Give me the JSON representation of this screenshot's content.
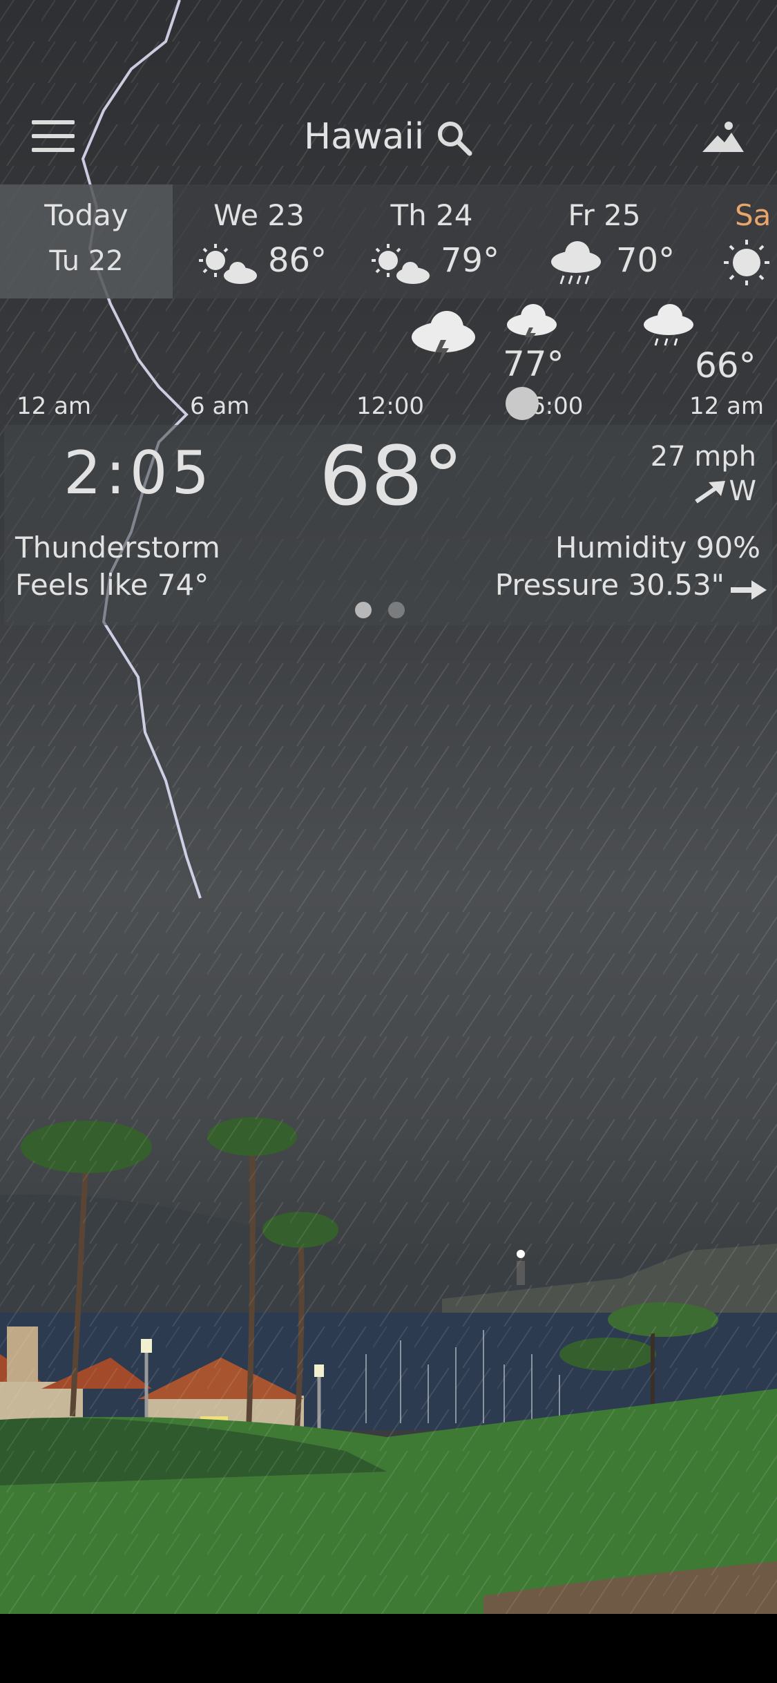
{
  "header": {
    "location": "Hawaii",
    "menu_icon": "hamburger-menu-icon",
    "search_icon": "search-icon",
    "scene_icon": "mountain-icon"
  },
  "days": [
    {
      "name": "Today",
      "sub": "Tu 22",
      "icon": "",
      "active": true
    },
    {
      "name": "We 23",
      "temp": "86°",
      "icon": "partly-sunny-icon"
    },
    {
      "name": "Th 24",
      "temp": "79°",
      "icon": "partly-sunny-icon"
    },
    {
      "name": "Fr 25",
      "temp": "70°",
      "icon": "rain-cloud-icon"
    },
    {
      "name": "Sa",
      "icon": "sun-icon"
    }
  ],
  "hourly": {
    "labels": [
      "12 am",
      "6 am",
      "12:00",
      "6:00",
      "12 am"
    ],
    "temps": [
      "77°",
      "66°"
    ],
    "icons": [
      "thunderstorm-icon",
      "thunderstorm-icon",
      "rain-cloud-icon"
    ]
  },
  "current": {
    "time": "2:05",
    "temp": "68°",
    "wind_speed": "27 mph",
    "wind_dir": "W",
    "condition": "Thunderstorm",
    "feels_like": "Feels like 74°",
    "humidity": "Humidity 90%",
    "pressure": "Pressure 30.53\""
  },
  "pager": {
    "count": 2,
    "active": 0
  },
  "colors": {
    "accent": "#e8a66a",
    "text": "#e2e2e2"
  }
}
